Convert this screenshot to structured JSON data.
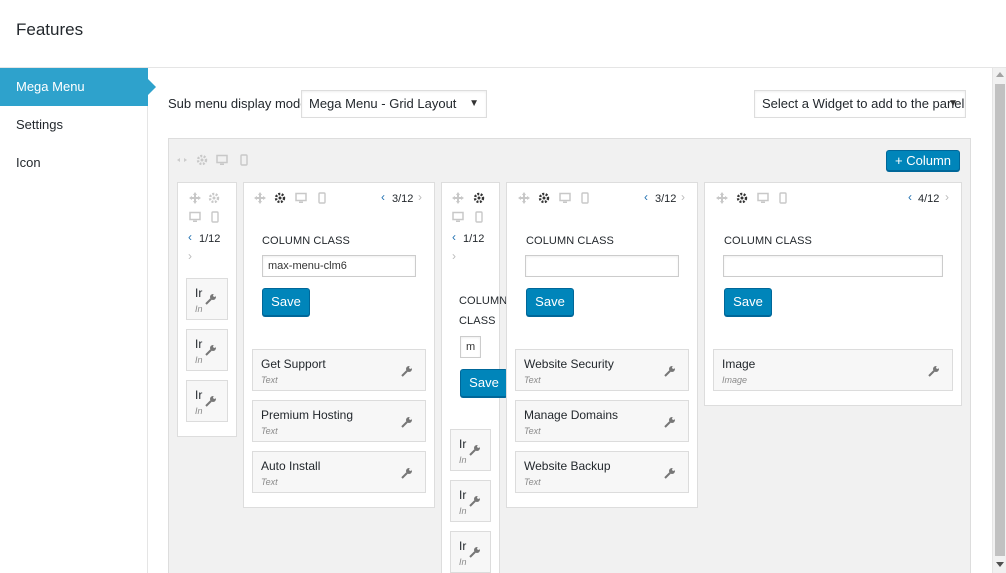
{
  "header": {
    "title": "Features"
  },
  "sidebar": {
    "items": [
      {
        "label": "Mega Menu",
        "active": true
      },
      {
        "label": "Settings",
        "active": false
      },
      {
        "label": "Icon",
        "active": false
      }
    ]
  },
  "controls": {
    "display_mode_label": "Sub menu display mode",
    "display_mode_value": "Mega Menu - Grid Layout",
    "widget_select_value": "Select a Widget to add to the panel"
  },
  "grid": {
    "add_column_label": "+ Column",
    "column_class_label": "COLUMN CLASS",
    "save_label": "Save",
    "columns": [
      {
        "width": "1/12",
        "widgets": [
          {
            "title": "Ir",
            "type": "In"
          },
          {
            "title": "Ir",
            "type": "In"
          },
          {
            "title": "Ir",
            "type": "In"
          }
        ]
      },
      {
        "width": "3/12",
        "class_value": "max-menu-clm6",
        "widgets": [
          {
            "title": "Get Support",
            "type": "Text"
          },
          {
            "title": "Premium Hosting",
            "type": "Text"
          },
          {
            "title": "Auto Install",
            "type": "Text"
          }
        ]
      },
      {
        "width": "1/12",
        "label_line1": "COLUMN",
        "label_line2": "CLASS",
        "class_value": "m",
        "widgets": [
          {
            "title": "Ir",
            "type": "In"
          },
          {
            "title": "Ir",
            "type": "In"
          },
          {
            "title": "Ir",
            "type": "In"
          }
        ]
      },
      {
        "width": "3/12",
        "class_value": "",
        "widgets": [
          {
            "title": "Website Security",
            "type": "Text"
          },
          {
            "title": "Manage Domains",
            "type": "Text"
          },
          {
            "title": "Website Backup",
            "type": "Text"
          }
        ]
      },
      {
        "width": "4/12",
        "class_value": "",
        "widgets": [
          {
            "title": "Image",
            "type": "Image"
          }
        ]
      }
    ]
  },
  "icons": {
    "move": "move-icon",
    "gear": "gear-icon",
    "desktop": "desktop-icon",
    "mobile": "mobile-icon",
    "wrench": "wrench-icon",
    "collapse": "collapse-icon"
  },
  "colors": {
    "accent": "#2ea2cc",
    "button": "#0085ba",
    "link": "#2271b1"
  }
}
